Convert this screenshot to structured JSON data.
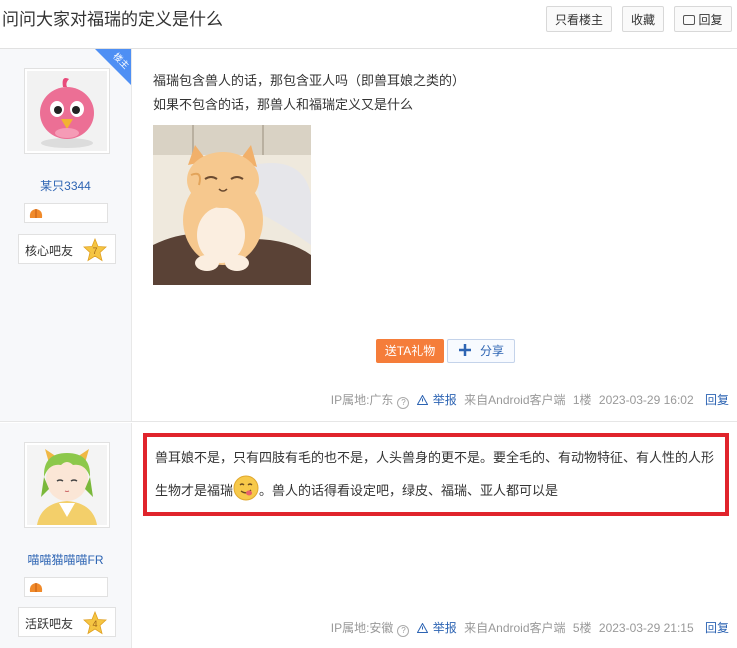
{
  "header": {
    "title": "问问大家对福瑞的定义是什么",
    "only_op_label": "只看楼主",
    "collect_label": "收藏",
    "reply_label": "回复"
  },
  "posts": [
    {
      "username": "某只3344",
      "op_badge": "楼主",
      "level_name": "核心吧友",
      "level_num": "7",
      "lines": [
        "福瑞包含兽人的话，那包含亚人吗（即兽耳娘之类的）",
        "如果不包含的话，那兽人和福瑞定义又是什么"
      ],
      "gift_label": "送TA礼物",
      "share_label": "分享",
      "ip": "IP属地:广东",
      "report": "举报",
      "source": "来自Android客户端",
      "floor": "1楼",
      "time": "2023-03-29 16:02",
      "reply": "回复"
    },
    {
      "username": "喵喵猫喵喵FR",
      "level_name": "活跃吧友",
      "level_num": "4",
      "text_part1": "兽耳娘不是，只有四肢有毛的也不是，人头兽身的更不是。要全毛的、有动物特征、有人性的人形生物才是福瑞",
      "text_part2": "。兽人的话得看设定吧，绿皮、福瑞、亚人都可以是",
      "ip": "IP属地:安徽",
      "report": "举报",
      "source": "来自Android客户端",
      "floor": "5楼",
      "time": "2023-03-29 21:15",
      "reply": "回复"
    }
  ],
  "colors": {
    "link_blue": "#2d64b3",
    "gift_orange": "#f57d3a",
    "highlight_red": "#e0242c",
    "level_gold": "#f5c542"
  }
}
